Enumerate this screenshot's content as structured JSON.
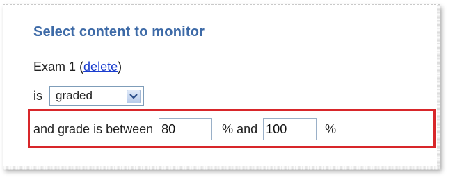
{
  "title": "Select content to monitor",
  "exam": {
    "name": "Exam 1",
    "paren_open": "(",
    "delete_label": "delete",
    "paren_close": ")"
  },
  "condition": {
    "is_label": "is",
    "selected_value": "graded"
  },
  "grade_range": {
    "prefix": "and grade is between",
    "min_value": "80",
    "middle": "% and",
    "max_value": "100",
    "suffix": "%"
  },
  "colors": {
    "title": "#3d6aa7",
    "link": "#1a3dcf",
    "highlight_border": "#d8262a"
  }
}
